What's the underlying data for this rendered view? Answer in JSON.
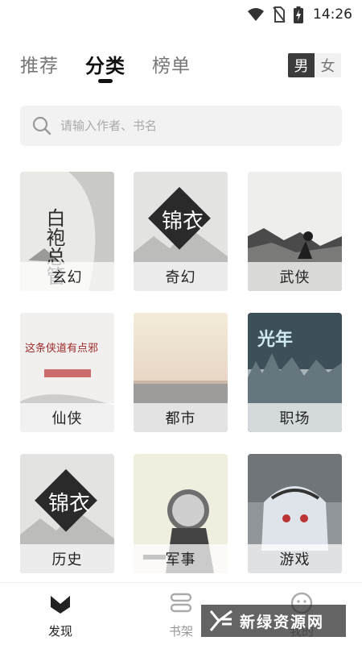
{
  "status_bar": {
    "time": "14:26"
  },
  "top_nav": {
    "tabs": [
      {
        "label": "推荐",
        "active": false
      },
      {
        "label": "分类",
        "active": true
      },
      {
        "label": "榜单",
        "active": false
      }
    ],
    "gender": [
      {
        "label": "男",
        "active": true
      },
      {
        "label": "女",
        "active": false
      }
    ]
  },
  "search": {
    "placeholder": "请输入作者、书名",
    "value": ""
  },
  "categories": [
    {
      "label": "玄幻",
      "cover_art": "白袍总管"
    },
    {
      "label": "奇幻",
      "cover_art": "锦衣"
    },
    {
      "label": "武侠",
      "cover_art": ""
    },
    {
      "label": "仙侠",
      "cover_art": "这条侠道有点邪"
    },
    {
      "label": "都市",
      "cover_art": ""
    },
    {
      "label": "职场",
      "cover_art": "光年"
    },
    {
      "label": "历史",
      "cover_art": "锦衣"
    },
    {
      "label": "军事",
      "cover_art": ""
    },
    {
      "label": "游戏",
      "cover_art": ""
    }
  ],
  "bottom_nav": [
    {
      "label": "发现",
      "icon": "discover-icon",
      "active": true
    },
    {
      "label": "书架",
      "icon": "bookshelf-icon",
      "active": false
    },
    {
      "label": "我的",
      "icon": "profile-icon",
      "active": false
    }
  ],
  "watermark": {
    "text": "新绿资源网"
  },
  "colors": {
    "active_text": "#111111",
    "inactive_text": "#777777",
    "search_bg": "#f2f2f2",
    "toggle_active": "#3b3b3b"
  }
}
